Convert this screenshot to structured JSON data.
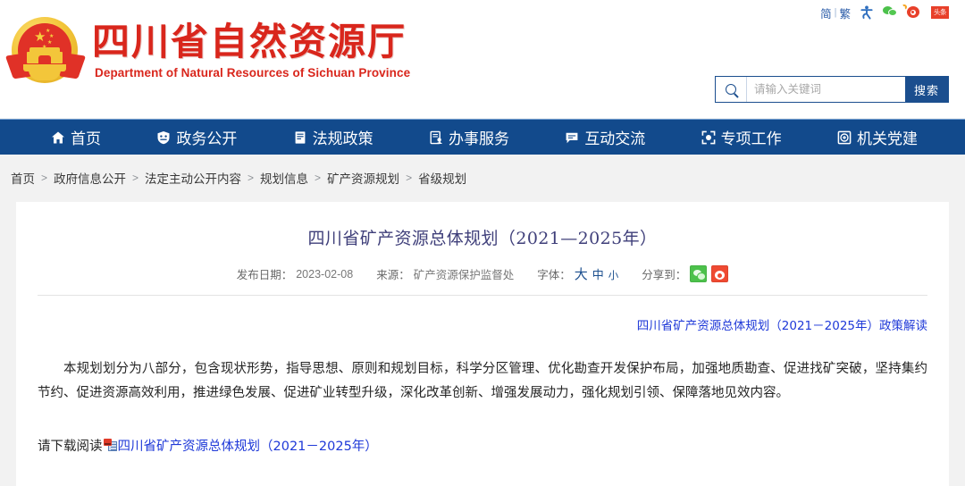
{
  "topbar": {
    "lang_simplified": "简",
    "lang_separator": "|",
    "lang_traditional": "繁",
    "icons": [
      "accessibility-icon",
      "wechat-icon",
      "weibo-icon",
      "toutiao-icon"
    ],
    "toutiao_label": "头条"
  },
  "header": {
    "site_name_cn": "四川省自然资源厅",
    "site_name_en": "Department of Natural Resources of Sichuan Province",
    "emblem": "national-emblem-icon"
  },
  "search": {
    "placeholder": "请输入关键词",
    "value": "",
    "button_label": "搜索",
    "icon": "search-icon"
  },
  "nav": {
    "items": [
      {
        "label": "首页",
        "icon": "home-icon"
      },
      {
        "label": "政务公开",
        "icon": "shield-icon"
      },
      {
        "label": "法规政策",
        "icon": "book-icon"
      },
      {
        "label": "办事服务",
        "icon": "form-user-icon"
      },
      {
        "label": "互动交流",
        "icon": "chat-bubble-icon"
      },
      {
        "label": "专项工作",
        "icon": "target-frame-icon"
      },
      {
        "label": "机关党建",
        "icon": "party-badge-icon"
      }
    ]
  },
  "breadcrumb": {
    "separator": ">",
    "items": [
      "首页",
      "政府信息公开",
      "法定主动公开内容",
      "规划信息",
      "矿产资源规划",
      "省级规划"
    ]
  },
  "article": {
    "title": "四川省矿产资源总体规划（2021—2025年）",
    "meta": {
      "date_label": "发布日期：",
      "date_value": "2023-02-08",
      "source_label": "来源：",
      "source_value": "矿产资源保护监督处",
      "fontsize_label": "字体：",
      "fontsize_large": "大",
      "fontsize_medium": "中",
      "fontsize_small": "小",
      "share_label": "分享到：",
      "share_icons": [
        "wechat-share-icon",
        "weibo-share-icon"
      ]
    },
    "policy_link": "四川省矿产资源总体规划（2021－2025年）政策解读",
    "body": "本规划划分为八部分，包含现状形势，指导思想、原则和规划目标，科学分区管理、优化勘查开发保护布局，加强地质勘查、促进找矿突破，坚持集约节约、促进资源高效利用，推进绿色发展、促进矿业转型升级，深化改革创新、增强发展动力，强化规划引领、保障落地见效内容。",
    "download_prefix": "请下载阅读",
    "download_icon": "pdf-file-icon",
    "download_link": "四川省矿产资源总体规划（2021－2025年）"
  },
  "colors": {
    "nav_blue": "#124a8c",
    "brand_red": "#d9261c",
    "link_blue": "#1f39d8",
    "page_bg": "#f2f2f2",
    "title_purple": "#3f3f7a"
  }
}
